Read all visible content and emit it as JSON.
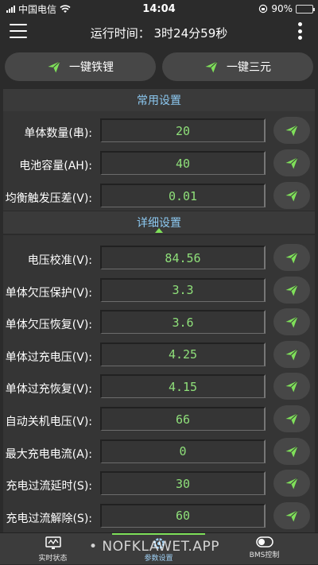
{
  "status": {
    "carrier": "中国电信",
    "time": "14:04",
    "battery": "90%",
    "battery_level": 0.9
  },
  "appbar": {
    "title": "运行时间：  3时24分59秒"
  },
  "quick": {
    "btn1": "一键铁锂",
    "btn2": "一键三元"
  },
  "common": {
    "title": "常用设置",
    "rows": [
      {
        "label": "单体数量(串):",
        "value": "20"
      },
      {
        "label": "电池容量(AH):",
        "value": "40"
      },
      {
        "label": "均衡触发压差(V):",
        "value": "0.01"
      }
    ]
  },
  "detail": {
    "title": "详细设置",
    "rows": [
      {
        "label": "电压校准(V):",
        "value": "84.56"
      },
      {
        "label": "单体欠压保护(V):",
        "value": "3.3"
      },
      {
        "label": "单体欠压恢复(V):",
        "value": "3.6"
      },
      {
        "label": "单体过充电压(V):",
        "value": "4.25"
      },
      {
        "label": "单体过充恢复(V):",
        "value": "4.15"
      },
      {
        "label": "自动关机电压(V):",
        "value": "66"
      },
      {
        "label": "最大充电电流(A):",
        "value": "0"
      },
      {
        "label": "充电过流延时(S):",
        "value": "30"
      },
      {
        "label": "充电过流解除(S):",
        "value": "60"
      }
    ]
  },
  "tabs": [
    {
      "label": "实时状态",
      "icon": "monitor-icon"
    },
    {
      "label": "参数设置",
      "icon": "gear-icon"
    },
    {
      "label": "BMS控制",
      "icon": "toggle-icon"
    }
  ],
  "watermark": "• NOFKLAWET.APP",
  "colors": {
    "value_green": "#8fe07a",
    "accent_blue": "#8cc8f0",
    "plane_green": "#7fe05a"
  }
}
